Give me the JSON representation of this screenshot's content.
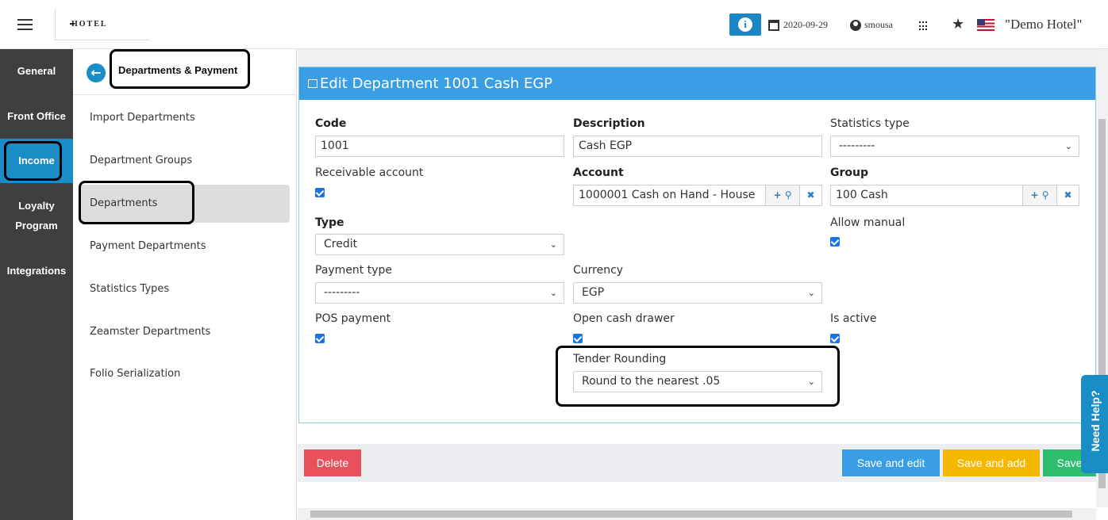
{
  "header": {
    "logo": "HOTEL",
    "info_icon": "i",
    "date": "2020-09-29",
    "username": "smousa",
    "hotel_name": "\"Demo Hotel\""
  },
  "left_nav": {
    "items": [
      {
        "label": "General"
      },
      {
        "label": "Front Office"
      },
      {
        "label": "Income",
        "active": true
      },
      {
        "label": "Loyalty"
      },
      {
        "label": "Program"
      },
      {
        "label": "Integrations"
      }
    ]
  },
  "sub_nav": {
    "back_icon": "←",
    "title": "Departments & Payment",
    "items": [
      {
        "label": "Import Departments"
      },
      {
        "label": "Department Groups"
      },
      {
        "label": "Departments",
        "selected": true
      },
      {
        "label": "Payment Departments"
      },
      {
        "label": "Statistics Types"
      },
      {
        "label": "Zeamster Departments"
      },
      {
        "label": "Folio Serialization"
      }
    ]
  },
  "form": {
    "title": "Edit Department 1001 Cash EGP",
    "code": {
      "label": "Code",
      "value": "1001"
    },
    "description": {
      "label": "Description",
      "value": "Cash EGP"
    },
    "statistics_type": {
      "label": "Statistics type",
      "value": "---------"
    },
    "receivable_account": {
      "label": "Receivable account",
      "checked": true
    },
    "account": {
      "label": "Account",
      "value": "1000001 Cash on Hand - House"
    },
    "group": {
      "label": "Group",
      "value": "100 Cash"
    },
    "type": {
      "label": "Type",
      "value": "Credit"
    },
    "allow_manual": {
      "label": "Allow manual",
      "checked": true
    },
    "payment_type": {
      "label": "Payment type",
      "value": "---------"
    },
    "currency": {
      "label": "Currency",
      "value": "EGP"
    },
    "pos_payment": {
      "label": "POS payment",
      "checked": true
    },
    "open_cash_drawer": {
      "label": "Open cash drawer",
      "checked": true
    },
    "is_active": {
      "label": "Is active",
      "checked": true
    },
    "tender_rounding": {
      "label": "Tender Rounding",
      "value": "Round to the nearest .05"
    },
    "addon_add": "+",
    "addon_search": "⚲",
    "addon_clear": "✖"
  },
  "actions": {
    "delete": "Delete",
    "save_and_edit": "Save and edit",
    "save_and_add": "Save and add",
    "save": "Save"
  },
  "help": {
    "label": "Need Help?"
  },
  "colors": {
    "primary": "#3a9ee4",
    "sidebar": "#3f3f3f",
    "active_nav": "#1a8dc7",
    "delete": "#e8505b",
    "save_add": "#f5b800",
    "save": "#2dbd6e"
  }
}
